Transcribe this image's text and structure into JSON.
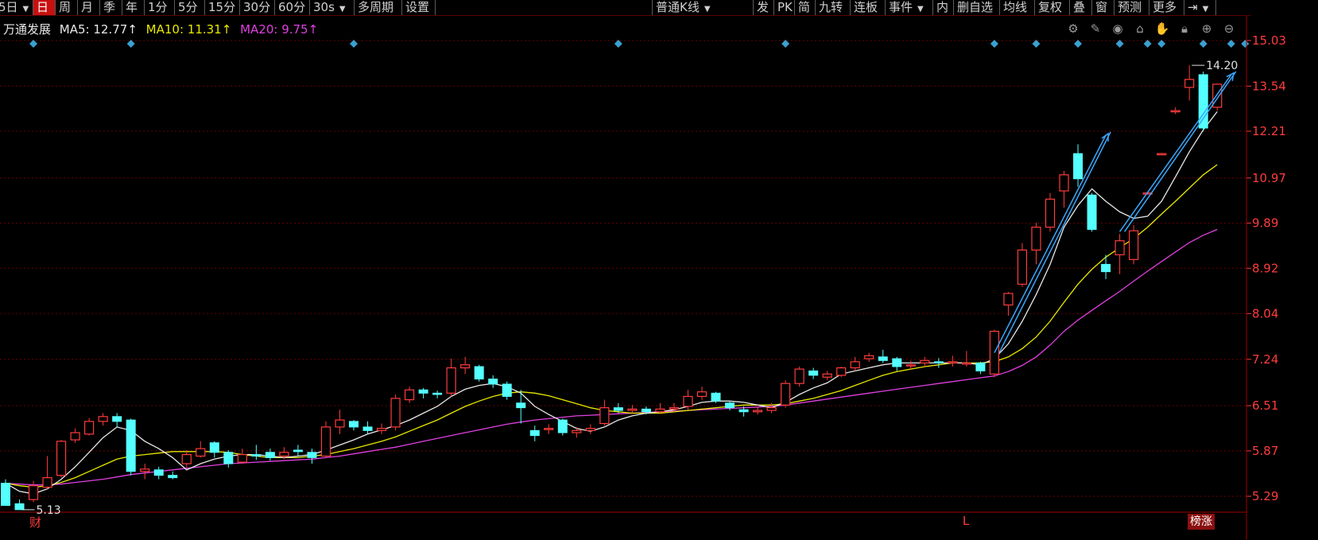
{
  "toolbar": {
    "items": [
      {
        "label": "5日",
        "caret": true,
        "active": false
      },
      {
        "label": "日",
        "caret": false,
        "active": true
      },
      {
        "label": "周",
        "caret": false,
        "active": false
      },
      {
        "label": "月",
        "caret": false,
        "active": false
      },
      {
        "label": "季",
        "caret": false,
        "active": false
      },
      {
        "label": "年",
        "caret": false,
        "active": false
      },
      {
        "label": "1分",
        "caret": false,
        "active": false
      },
      {
        "label": "5分",
        "caret": false,
        "active": false
      },
      {
        "label": "15分",
        "caret": false,
        "active": false
      },
      {
        "label": "30分",
        "caret": false,
        "active": false
      },
      {
        "label": "60分",
        "caret": false,
        "active": false
      },
      {
        "label": "30s",
        "caret": true,
        "active": false
      },
      {
        "label": "多周期",
        "caret": false,
        "active": false
      },
      {
        "label": "设置",
        "caret": false,
        "active": false
      }
    ],
    "right_items": [
      {
        "label": "普通K线",
        "caret": true
      },
      {
        "label": "发",
        "caret": false
      },
      {
        "label": "PK",
        "caret": false
      },
      {
        "label": "简",
        "caret": false
      },
      {
        "label": "九转",
        "caret": false
      },
      {
        "label": "连板",
        "caret": false
      },
      {
        "label": "事件",
        "caret": true
      },
      {
        "label": "内",
        "caret": false
      },
      {
        "label": "删自选",
        "caret": false
      },
      {
        "label": "均线",
        "caret": false
      },
      {
        "label": "复权",
        "caret": false
      },
      {
        "label": "叠",
        "caret": false
      },
      {
        "label": "窗",
        "caret": false
      },
      {
        "label": "预测",
        "caret": false
      },
      {
        "label": "更多",
        "caret": false
      },
      {
        "label": "⇥",
        "caret": true
      }
    ]
  },
  "info": {
    "stock_name": "万通发展",
    "ma5": "MA5: 12.77↑",
    "ma10": "MA10: 11.31↑",
    "ma20": "MA20: 9.75↑"
  },
  "tool_icons": [
    "settings-icon",
    "pen-icon",
    "eye-icon",
    "stamp-icon",
    "hand-icon",
    "lock-icon",
    "zoom-in-icon",
    "zoom-out-icon"
  ],
  "colors": {
    "up": "#ff3c3c",
    "down": "#54ffff",
    "ma5": "#e8e8e8",
    "ma10": "#e8e800",
    "ma20": "#e040e0",
    "grid": "#6a0000",
    "diamond": "#3aa0d0",
    "arrow": "#3aa8ff"
  },
  "chart_data": {
    "type": "candlestick",
    "yticks": [
      "15.03",
      "13.54",
      "12.21",
      "10.97",
      "9.89",
      "8.92",
      "8.04",
      "7.24",
      "6.51",
      "5.87",
      "5.29"
    ],
    "ylim": [
      5.1,
      15.3
    ],
    "y_scale": "log",
    "candles": [
      [
        5.45,
        5.18,
        5.5,
        5.18
      ],
      [
        5.2,
        5.13,
        5.25,
        5.13
      ],
      [
        5.25,
        5.42,
        5.48,
        5.22
      ],
      [
        5.4,
        5.52,
        5.8,
        5.38
      ],
      [
        5.55,
        6.0,
        6.02,
        5.52
      ],
      [
        6.02,
        6.12,
        6.18,
        5.98
      ],
      [
        6.1,
        6.28,
        6.33,
        6.08
      ],
      [
        6.28,
        6.35,
        6.4,
        6.22
      ],
      [
        6.35,
        6.28,
        6.4,
        6.2
      ],
      [
        6.3,
        5.6,
        6.32,
        5.55
      ],
      [
        5.6,
        5.63,
        5.7,
        5.5
      ],
      [
        5.62,
        5.55,
        5.66,
        5.5
      ],
      [
        5.55,
        5.52,
        5.6,
        5.5
      ],
      [
        5.7,
        5.82,
        5.88,
        5.65
      ],
      [
        5.8,
        5.9,
        6.0,
        5.78
      ],
      [
        5.98,
        5.85,
        6.0,
        5.78
      ],
      [
        5.85,
        5.7,
        5.88,
        5.65
      ],
      [
        5.72,
        5.82,
        5.9,
        5.7
      ],
      [
        5.82,
        5.8,
        5.95,
        5.75
      ],
      [
        5.85,
        5.78,
        5.9,
        5.74
      ],
      [
        5.8,
        5.85,
        5.92,
        5.76
      ],
      [
        5.88,
        5.86,
        5.95,
        5.8
      ],
      [
        5.85,
        5.78,
        5.9,
        5.7
      ],
      [
        5.8,
        6.2,
        6.28,
        5.78
      ],
      [
        6.2,
        6.3,
        6.45,
        6.1
      ],
      [
        6.28,
        6.2,
        6.3,
        6.15
      ],
      [
        6.2,
        6.15,
        6.28,
        6.1
      ],
      [
        6.15,
        6.18,
        6.25,
        6.1
      ],
      [
        6.2,
        6.62,
        6.68,
        6.15
      ],
      [
        6.6,
        6.75,
        6.8,
        6.55
      ],
      [
        6.75,
        6.7,
        6.78,
        6.62
      ],
      [
        6.7,
        6.68,
        6.74,
        6.62
      ],
      [
        6.7,
        7.1,
        7.25,
        6.65
      ],
      [
        7.1,
        7.15,
        7.28,
        7.0
      ],
      [
        7.12,
        6.92,
        7.15,
        6.88
      ],
      [
        6.92,
        6.84,
        6.98,
        6.78
      ],
      [
        6.84,
        6.65,
        6.88,
        6.6
      ],
      [
        6.55,
        6.48,
        6.75,
        6.25
      ],
      [
        6.15,
        6.08,
        6.22,
        6.0
      ],
      [
        6.18,
        6.18,
        6.24,
        6.1
      ],
      [
        6.3,
        6.12,
        6.32,
        6.08
      ],
      [
        6.12,
        6.15,
        6.2,
        6.05
      ],
      [
        6.15,
        6.18,
        6.24,
        6.1
      ],
      [
        6.25,
        6.48,
        6.6,
        6.22
      ],
      [
        6.48,
        6.44,
        6.55,
        6.4
      ],
      [
        6.44,
        6.46,
        6.52,
        6.4
      ],
      [
        6.46,
        6.42,
        6.5,
        6.38
      ],
      [
        6.42,
        6.46,
        6.55,
        6.4
      ],
      [
        6.46,
        6.48,
        6.55,
        6.42
      ],
      [
        6.5,
        6.65,
        6.75,
        6.45
      ],
      [
        6.65,
        6.72,
        6.8,
        6.6
      ],
      [
        6.7,
        6.58,
        6.72,
        6.55
      ],
      [
        6.55,
        6.48,
        6.58,
        6.44
      ],
      [
        6.45,
        6.42,
        6.5,
        6.35
      ],
      [
        6.42,
        6.44,
        6.5,
        6.38
      ],
      [
        6.44,
        6.48,
        6.55,
        6.4
      ],
      [
        6.52,
        6.85,
        6.9,
        6.48
      ],
      [
        6.85,
        7.08,
        7.12,
        6.8
      ],
      [
        7.05,
        6.98,
        7.1,
        6.92
      ],
      [
        6.95,
        7.0,
        7.05,
        6.9
      ],
      [
        6.98,
        7.1,
        7.12,
        6.95
      ],
      [
        7.1,
        7.2,
        7.28,
        7.05
      ],
      [
        7.25,
        7.3,
        7.35,
        7.2
      ],
      [
        7.28,
        7.22,
        7.4,
        7.18
      ],
      [
        7.25,
        7.12,
        7.28,
        7.05
      ],
      [
        7.15,
        7.15,
        7.22,
        7.08
      ],
      [
        7.18,
        7.22,
        7.28,
        7.12
      ],
      [
        7.2,
        7.18,
        7.26,
        7.1
      ],
      [
        7.18,
        7.2,
        7.3,
        7.12
      ],
      [
        7.18,
        7.18,
        7.38,
        7.12
      ],
      [
        7.18,
        7.05,
        7.2,
        7.0
      ],
      [
        7.0,
        7.72,
        7.75,
        6.95
      ],
      [
        8.2,
        8.42,
        8.45,
        8.0
      ],
      [
        8.6,
        9.3,
        9.45,
        8.55
      ],
      [
        9.3,
        9.8,
        9.9,
        9.0
      ],
      [
        9.8,
        10.45,
        10.6,
        9.7
      ],
      [
        10.65,
        11.05,
        11.15,
        10.25
      ],
      [
        11.6,
        10.95,
        11.85,
        10.75
      ],
      [
        10.55,
        9.75,
        10.6,
        9.7
      ],
      [
        9.0,
        8.85,
        9.2,
        8.7
      ],
      [
        9.2,
        9.5,
        9.65,
        8.8
      ],
      [
        9.1,
        9.72,
        9.85,
        9.0
      ],
      [
        10.6,
        10.6,
        10.62,
        10.58
      ],
      [
        11.6,
        11.6,
        11.62,
        11.58
      ],
      [
        12.8,
        12.8,
        12.9,
        12.7
      ],
      [
        13.5,
        13.75,
        14.2,
        13.1
      ],
      [
        13.9,
        12.3,
        14.0,
        12.2
      ],
      [
        12.9,
        13.6,
        13.62,
        12.8
      ]
    ],
    "ma5": [
      5.45,
      5.35,
      5.32,
      5.38,
      5.5,
      5.66,
      5.85,
      6.05,
      6.2,
      6.15,
      6.0,
      5.9,
      5.78,
      5.62,
      5.7,
      5.76,
      5.8,
      5.82,
      5.82,
      5.8,
      5.78,
      5.8,
      5.82,
      5.88,
      5.95,
      6.02,
      6.1,
      6.16,
      6.22,
      6.3,
      6.4,
      6.5,
      6.65,
      6.76,
      6.82,
      6.85,
      6.8,
      6.7,
      6.5,
      6.38,
      6.28,
      6.18,
      6.14,
      6.2,
      6.3,
      6.36,
      6.4,
      6.42,
      6.45,
      6.5,
      6.56,
      6.58,
      6.58,
      6.56,
      6.52,
      6.48,
      6.56,
      6.68,
      6.78,
      6.86,
      7.0,
      7.05,
      7.1,
      7.15,
      7.18,
      7.18,
      7.18,
      7.18,
      7.18,
      7.18,
      7.15,
      7.25,
      7.5,
      7.9,
      8.4,
      9.0,
      9.8,
      10.3,
      10.7,
      10.4,
      10.15,
      10.0,
      10.05,
      10.4,
      11.0,
      11.65,
      12.25,
      12.77
    ],
    "ma10": [
      5.45,
      5.42,
      5.4,
      5.42,
      5.46,
      5.52,
      5.6,
      5.68,
      5.76,
      5.8,
      5.82,
      5.84,
      5.86,
      5.86,
      5.86,
      5.86,
      5.85,
      5.82,
      5.8,
      5.78,
      5.78,
      5.78,
      5.8,
      5.82,
      5.86,
      5.9,
      5.95,
      6.0,
      6.06,
      6.14,
      6.22,
      6.3,
      6.4,
      6.5,
      6.58,
      6.65,
      6.7,
      6.72,
      6.7,
      6.66,
      6.6,
      6.54,
      6.48,
      6.44,
      6.42,
      6.4,
      6.4,
      6.4,
      6.42,
      6.44,
      6.46,
      6.48,
      6.5,
      6.52,
      6.52,
      6.52,
      6.54,
      6.58,
      6.62,
      6.68,
      6.74,
      6.82,
      6.9,
      6.98,
      7.04,
      7.08,
      7.12,
      7.15,
      7.18,
      7.18,
      7.18,
      7.2,
      7.28,
      7.42,
      7.62,
      7.9,
      8.25,
      8.6,
      8.9,
      9.15,
      9.35,
      9.55,
      9.8,
      10.1,
      10.4,
      10.72,
      11.05,
      11.31
    ],
    "ma20": [
      5.45,
      5.44,
      5.43,
      5.43,
      5.44,
      5.46,
      5.48,
      5.5,
      5.53,
      5.56,
      5.58,
      5.6,
      5.62,
      5.64,
      5.66,
      5.68,
      5.7,
      5.71,
      5.72,
      5.73,
      5.74,
      5.75,
      5.76,
      5.78,
      5.8,
      5.83,
      5.86,
      5.89,
      5.92,
      5.96,
      6.0,
      6.04,
      6.08,
      6.12,
      6.16,
      6.2,
      6.24,
      6.27,
      6.3,
      6.32,
      6.34,
      6.36,
      6.37,
      6.38,
      6.39,
      6.4,
      6.41,
      6.42,
      6.43,
      6.44,
      6.45,
      6.46,
      6.47,
      6.48,
      6.49,
      6.5,
      6.52,
      6.55,
      6.58,
      6.61,
      6.64,
      6.67,
      6.7,
      6.73,
      6.76,
      6.79,
      6.82,
      6.85,
      6.88,
      6.91,
      6.94,
      6.97,
      7.04,
      7.14,
      7.28,
      7.48,
      7.72,
      7.92,
      8.1,
      8.28,
      8.46,
      8.66,
      8.86,
      9.06,
      9.26,
      9.46,
      9.62,
      9.75
    ],
    "annotations": [
      {
        "label": "5.13",
        "price": 5.13,
        "index": 1
      },
      {
        "label": "14.20",
        "price": 14.2,
        "index": 85
      }
    ],
    "event_markers": [
      2,
      9,
      25,
      44,
      56,
      71,
      74,
      77,
      80,
      82,
      83,
      86,
      88,
      89
    ],
    "arrows": [
      {
        "from_index": 71,
        "from_price": 7.35,
        "to_index": 79,
        "to_price": 12.1
      },
      {
        "from_index": 80,
        "from_price": 9.7,
        "to_index": 88,
        "to_price": 13.9
      }
    ],
    "bottom_markers": [
      {
        "label": "财",
        "index": 0
      },
      {
        "label": "L",
        "index": 67
      }
    ],
    "bottom_badge": "榜涨"
  }
}
